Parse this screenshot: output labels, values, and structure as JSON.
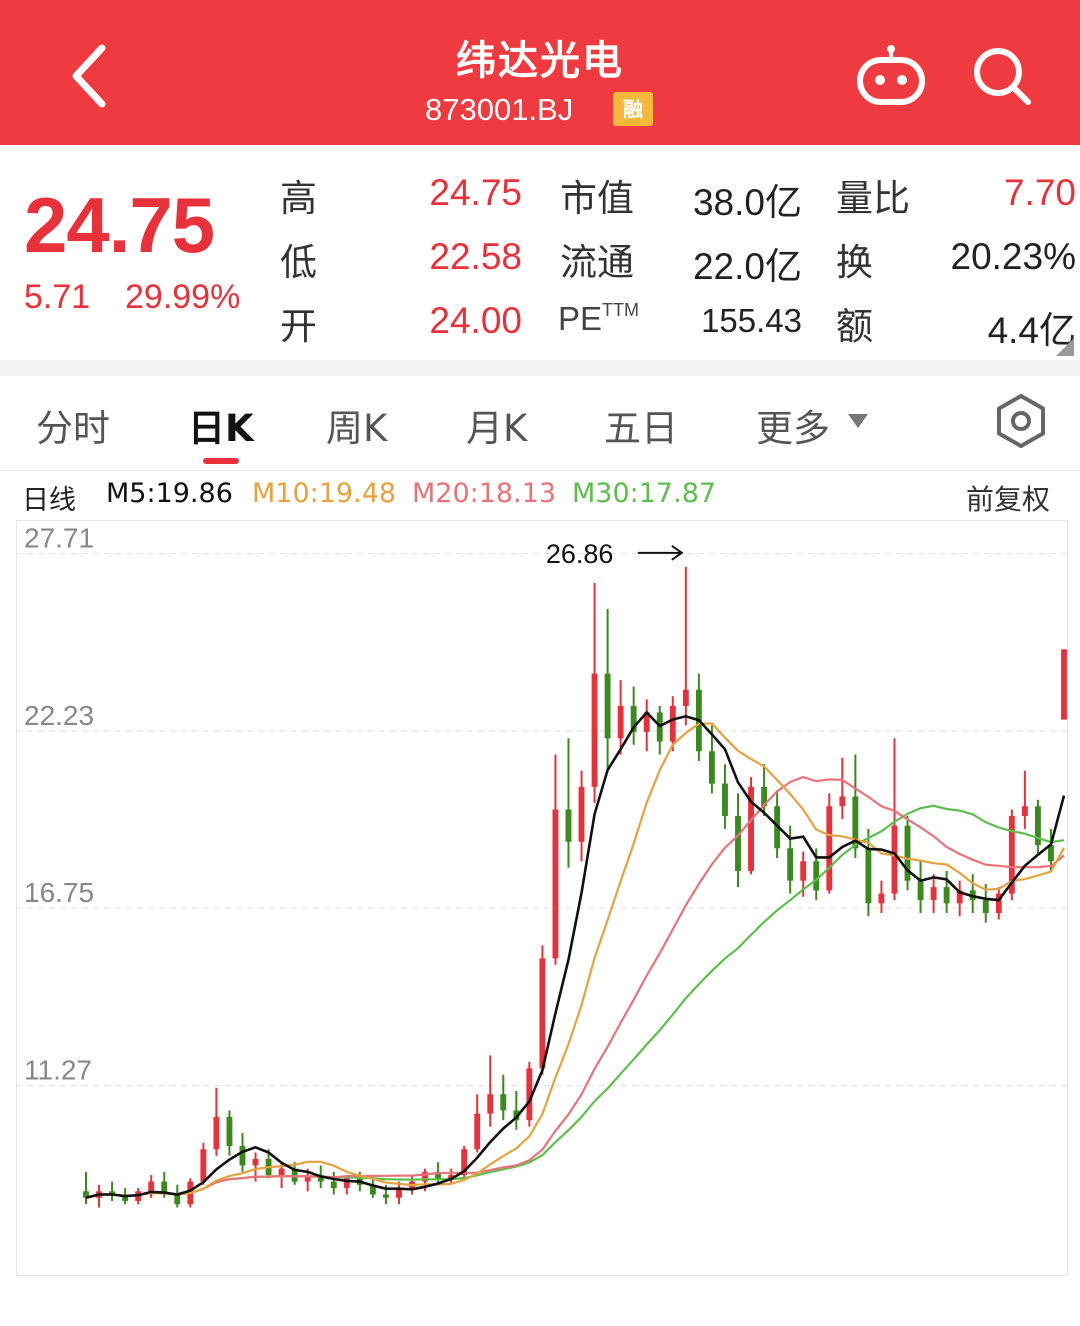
{
  "header": {
    "title": "纬达光电",
    "code": "873001.BJ",
    "badge": "融",
    "back_icon": "chevron-left-icon",
    "robot_icon": "robot-icon",
    "search_icon": "search-icon"
  },
  "quote": {
    "price": "24.75",
    "change": "5.71",
    "change_pct": "29.99%",
    "high_label": "高",
    "high": "24.75",
    "low_label": "低",
    "low": "22.58",
    "open_label": "开",
    "open": "24.00",
    "mcap_label": "市值",
    "mcap": "38.0亿",
    "float_label": "流通",
    "float": "22.0亿",
    "pe_label": "PE",
    "pe_sup": "TTM",
    "pe": "155.43",
    "vol_ratio_label": "量比",
    "vol_ratio": "7.70",
    "turnover_label": "换",
    "turnover": "20.23%",
    "amount_label": "额",
    "amount": "4.4亿",
    "up_color": "#e8313a",
    "down_color": "#3a8a1e"
  },
  "tabs": [
    {
      "label": "分时",
      "active": false
    },
    {
      "label": "日K",
      "active": true
    },
    {
      "label": "周K",
      "active": false
    },
    {
      "label": "月K",
      "active": false
    },
    {
      "label": "五日",
      "active": false
    },
    {
      "label": "更多",
      "active": false
    }
  ],
  "settings_icon": "hexagon-settings-icon",
  "ma_bar": {
    "period": "日线",
    "m5": "M5:19.86",
    "m10": "M10:19.48",
    "m20": "M20:18.13",
    "m30": "M30:17.87",
    "adjust": "前复权",
    "colors": {
      "m5": "#111111",
      "m10": "#e6a23c",
      "m20": "#e8737a",
      "m30": "#5cbf4c"
    }
  },
  "chart_data": {
    "type": "candlestick",
    "y_ticks": [
      "27.71",
      "22.23",
      "16.75",
      "11.27"
    ],
    "y_tick_values": [
      27.71,
      22.23,
      16.75,
      11.27
    ],
    "ylim": [
      6.0,
      28.5
    ],
    "annotation": "26.86",
    "annotation_value": 26.86,
    "grid": "horizontal dashed",
    "candles": [
      [
        8.0,
        8.6,
        7.6,
        7.8
      ],
      [
        7.8,
        8.2,
        7.5,
        8.0
      ],
      [
        8.0,
        8.3,
        7.7,
        7.9
      ],
      [
        7.9,
        8.1,
        7.6,
        7.7
      ],
      [
        7.7,
        8.1,
        7.6,
        8.0
      ],
      [
        8.0,
        8.5,
        7.8,
        8.3
      ],
      [
        8.3,
        8.6,
        7.8,
        7.9
      ],
      [
        7.9,
        8.2,
        7.5,
        7.6
      ],
      [
        7.6,
        8.4,
        7.5,
        8.3
      ],
      [
        8.3,
        9.5,
        8.2,
        9.3
      ],
      [
        9.3,
        11.2,
        9.1,
        10.3
      ],
      [
        10.3,
        10.5,
        9.1,
        9.4
      ],
      [
        9.4,
        9.8,
        8.6,
        8.8
      ],
      [
        8.8,
        9.2,
        8.3,
        9.0
      ],
      [
        9.0,
        9.3,
        8.4,
        8.5
      ],
      [
        8.5,
        8.9,
        8.1,
        8.7
      ],
      [
        8.7,
        8.9,
        8.2,
        8.3
      ],
      [
        8.3,
        8.7,
        8.0,
        8.5
      ],
      [
        8.5,
        8.8,
        8.1,
        8.3
      ],
      [
        8.3,
        8.6,
        7.9,
        8.1
      ],
      [
        8.1,
        8.5,
        7.9,
        8.4
      ],
      [
        8.4,
        8.6,
        8.0,
        8.2
      ],
      [
        8.2,
        8.5,
        7.8,
        7.9
      ],
      [
        7.9,
        8.2,
        7.6,
        7.8
      ],
      [
        7.8,
        8.3,
        7.6,
        8.1
      ],
      [
        8.1,
        8.5,
        7.9,
        8.3
      ],
      [
        8.3,
        8.7,
        8.0,
        8.6
      ],
      [
        8.6,
        8.9,
        8.2,
        8.4
      ],
      [
        8.4,
        8.7,
        8.2,
        8.5
      ],
      [
        8.5,
        9.4,
        8.4,
        9.3
      ],
      [
        9.3,
        11.0,
        9.2,
        10.4
      ],
      [
        10.4,
        12.2,
        10.0,
        11.0
      ],
      [
        11.0,
        11.6,
        10.2,
        10.5
      ],
      [
        10.5,
        11.1,
        9.9,
        10.2
      ],
      [
        10.2,
        12.0,
        10.0,
        11.8
      ],
      [
        11.8,
        15.6,
        11.6,
        15.2
      ],
      [
        15.2,
        21.5,
        15.0,
        19.8
      ],
      [
        19.8,
        22.0,
        18.0,
        18.8
      ],
      [
        18.8,
        21.0,
        18.2,
        20.5
      ],
      [
        20.5,
        26.8,
        20.0,
        24.0
      ],
      [
        24.0,
        26.0,
        21.0,
        22.0
      ],
      [
        22.0,
        23.8,
        21.5,
        23.0
      ],
      [
        23.0,
        23.6,
        21.8,
        22.2
      ],
      [
        22.2,
        23.2,
        21.6,
        22.8
      ],
      [
        22.8,
        23.0,
        21.5,
        21.9
      ],
      [
        21.9,
        23.3,
        21.6,
        23.0
      ],
      [
        23.0,
        27.3,
        22.4,
        23.5
      ],
      [
        23.5,
        24.0,
        21.3,
        21.6
      ],
      [
        21.6,
        22.4,
        20.3,
        20.6
      ],
      [
        20.6,
        21.2,
        19.2,
        19.6
      ],
      [
        19.6,
        20.3,
        17.4,
        17.9
      ],
      [
        17.9,
        20.8,
        17.8,
        20.5
      ],
      [
        20.5,
        21.2,
        19.6,
        19.9
      ],
      [
        19.9,
        20.4,
        18.3,
        18.6
      ],
      [
        18.6,
        19.3,
        17.2,
        17.6
      ],
      [
        17.6,
        18.5,
        17.1,
        18.2
      ],
      [
        18.2,
        18.6,
        17.0,
        17.3
      ],
      [
        17.3,
        20.3,
        17.2,
        19.9
      ],
      [
        19.9,
        21.4,
        19.5,
        20.2
      ],
      [
        20.2,
        21.5,
        18.3,
        18.6
      ],
      [
        18.6,
        19.2,
        16.5,
        16.9
      ],
      [
        16.9,
        17.6,
        16.6,
        17.2
      ],
      [
        17.2,
        22.0,
        17.0,
        19.3
      ],
      [
        19.3,
        19.6,
        17.3,
        17.6
      ],
      [
        17.6,
        18.2,
        16.6,
        17.0
      ],
      [
        17.0,
        17.8,
        16.6,
        17.4
      ],
      [
        17.4,
        17.9,
        16.6,
        16.9
      ],
      [
        16.9,
        17.6,
        16.5,
        17.3
      ],
      [
        17.3,
        17.8,
        16.6,
        17.0
      ],
      [
        17.0,
        17.5,
        16.3,
        16.6
      ],
      [
        16.6,
        17.4,
        16.4,
        17.2
      ],
      [
        17.2,
        19.8,
        17.0,
        19.6
      ],
      [
        19.6,
        21.0,
        19.2,
        19.9
      ],
      [
        19.9,
        20.1,
        18.4,
        18.7
      ],
      [
        18.7,
        19.2,
        17.9,
        18.2
      ],
      [
        22.58,
        24.75,
        22.58,
        24.75
      ]
    ]
  }
}
